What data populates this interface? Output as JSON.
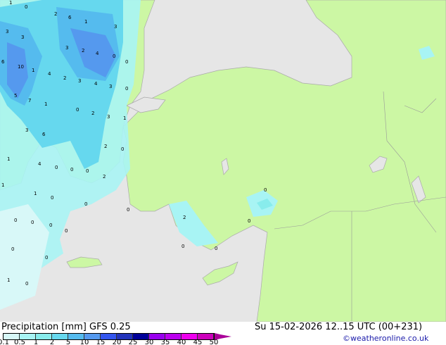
{
  "title": "Precipitation [mm] GFS 0.25",
  "datetime": "Su 15-02-2026 12..15 UTC (00+231)",
  "credit": "©weatheronline.co.uk",
  "colors": {
    "sea": "#e6e6e6",
    "land": "#ccf7a4",
    "coast": "#aaaaaa"
  },
  "legend": {
    "ticks": [
      "0.1",
      "0.5",
      "1",
      "2",
      "5",
      "10",
      "15",
      "20",
      "25",
      "30",
      "35",
      "40",
      "45",
      "50"
    ],
    "colors": [
      "#d8f8f8",
      "#a8f4f4",
      "#88ecec",
      "#66d8ee",
      "#55bbee",
      "#5599ee",
      "#3355ee",
      "#2233bb",
      "#000099",
      "#9900ee",
      "#bb00ee",
      "#ee00ee",
      "#cc00bb"
    ],
    "arrow_color": "#aa0099"
  },
  "map_labels": [
    "1",
    "0",
    "2",
    "6",
    "1",
    "3",
    "3",
    "3",
    "3",
    "2",
    "4",
    "0",
    "6",
    "10",
    "1",
    "0",
    "4",
    "2",
    "3",
    "4",
    "3",
    "0",
    "5",
    "7",
    "1",
    "0",
    "2",
    "3",
    "1",
    "3",
    "6",
    "2",
    "0",
    "1",
    "4",
    "0",
    "0",
    "0",
    "2",
    "1",
    "0",
    "1",
    "0",
    "0",
    "0",
    "0",
    "0",
    "2",
    "0",
    "0",
    "0",
    "0",
    "0",
    "0",
    "1",
    "0",
    "0"
  ]
}
